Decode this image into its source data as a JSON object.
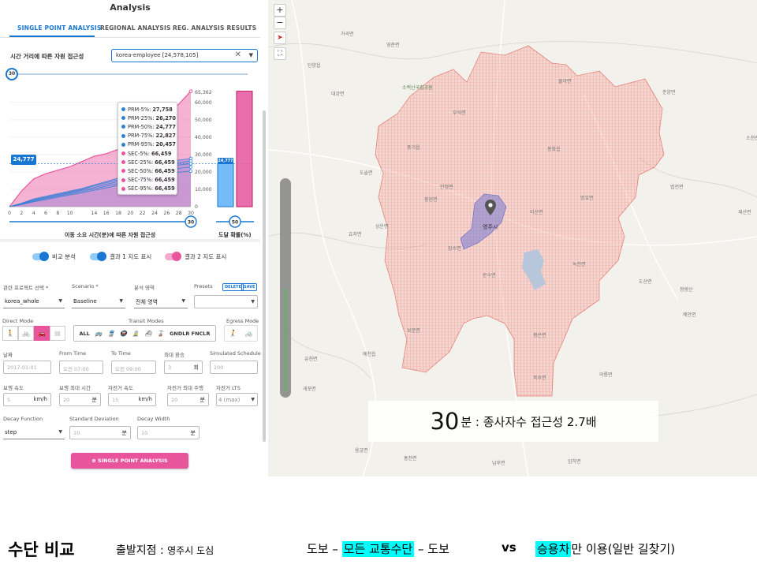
{
  "panel": {
    "title": "Analysis",
    "tabs": [
      "SINGLE POINT ANALYSIS",
      "REGIONAL ANALYSIS",
      "REG. ANALYSIS RESULTS"
    ],
    "accessibility_label": "시간 거리에 따른 자원 접근성",
    "dataset": "korea-employee [24,578,105]",
    "time_cutoff": "30",
    "value_badge": "24,777",
    "bar_badge": "24,777",
    "xaxis_title": "이동 소요 시간(분)에 따른 자원 접근성",
    "prob_title": "도달 확률(%)",
    "prob_value": "50",
    "toggles": {
      "compare": "비교 분석",
      "result1": "결과 1 지도 표시",
      "result2": "결과 2 지도 표시"
    },
    "fields": {
      "project_label": "관련 프로젝트 선택 *",
      "project_value": "korea_whole",
      "scenario_label": "Scenario *",
      "scenario_value": "Baseline",
      "area_label": "분석 영역",
      "area_value": "전체 영역",
      "presets_label": "Presets",
      "delete_label": "DELETE",
      "save_label": "SAVE",
      "direct_label": "Direct Mode",
      "transit_label": "Transit Modes",
      "egress_label": "Egress Mode",
      "transit_all": "ALL",
      "transit_extra": "GNDLR FNCLR",
      "date_label": "날짜",
      "date_value": "2017-01-01",
      "from_label": "From Time",
      "from_value": "오전 07:00",
      "to_label": "To Time",
      "to_value": "오전 09:00",
      "transfer_label": "최대 환승",
      "transfer_value": "3",
      "transfer_unit": "회",
      "sim_label": "Simulated Schedule",
      "sim_value": "200",
      "walk_speed_label": "보행 속도",
      "walk_speed_value": "5",
      "walk_speed_unit": "km/h",
      "walk_time_label": "보행 최대 시간",
      "walk_time_value": "20",
      "walk_time_unit": "분",
      "bike_speed_label": "자전거 속도",
      "bike_speed_value": "15",
      "bike_speed_unit": "km/h",
      "bike_time_label": "자전거 최대 주행",
      "bike_time_value": "20",
      "bike_time_unit": "분",
      "bike_lts_label": "자전거 LTS",
      "bike_lts_value": "4 (max)",
      "decay_label": "Decay Function",
      "decay_value": "step",
      "std_label": "Standard Deviation",
      "std_value": "10",
      "std_unit": "분",
      "width_label": "Decay Width",
      "width_value": "10",
      "width_unit": "분"
    },
    "run_label": "SINGLE POINT ANALYSIS"
  },
  "chart_data": {
    "type": "area",
    "x": [
      0,
      2,
      4,
      6,
      8,
      10,
      12,
      14,
      16,
      18,
      20,
      22,
      24,
      26,
      28,
      30
    ],
    "x_tick_labels": [
      "0",
      "2",
      "4",
      "6",
      "8",
      "10",
      "14",
      "16",
      "18",
      "20",
      "22",
      "24",
      "26",
      "28",
      "30"
    ],
    "y_tick_labels": [
      "0",
      "10,000",
      "20,000",
      "30,000",
      "40,000",
      "50,000",
      "60,000"
    ],
    "y_max_label": "65,362",
    "ylim": [
      0,
      65362
    ],
    "series": [
      {
        "name": "PRM-5%",
        "values": [
          0,
          2000,
          4500,
          6000,
          7500,
          9000,
          10500,
          12500,
          14500,
          16500,
          18500,
          21000,
          23500,
          25500,
          26800,
          27758
        ]
      },
      {
        "name": "PRM-25%",
        "values": [
          0,
          1800,
          4000,
          5500,
          7000,
          8500,
          10000,
          12000,
          13800,
          15500,
          17500,
          19500,
          21500,
          23500,
          25200,
          26270
        ]
      },
      {
        "name": "PRM-50%",
        "values": [
          0,
          1600,
          3600,
          5000,
          6500,
          8000,
          9500,
          11000,
          12800,
          14500,
          16500,
          18500,
          20500,
          22500,
          24000,
          24777
        ]
      },
      {
        "name": "PRM-75%",
        "values": [
          0,
          1400,
          3200,
          4600,
          6000,
          7400,
          8800,
          10200,
          11800,
          13500,
          15200,
          17000,
          19000,
          20800,
          22000,
          22827
        ]
      },
      {
        "name": "PRM-95%",
        "values": [
          0,
          1200,
          2800,
          4000,
          5400,
          6800,
          8000,
          9400,
          10800,
          12400,
          14000,
          15600,
          17200,
          18800,
          19800,
          20457
        ]
      },
      {
        "name": "SEC-5%",
        "values": [
          0,
          9000,
          16000,
          19000,
          21000,
          23000,
          26000,
          29000,
          30500,
          33000,
          37000,
          41000,
          46000,
          52000,
          59000,
          66459
        ]
      },
      {
        "name": "SEC-25%",
        "values": [
          0,
          9000,
          16000,
          19000,
          21000,
          23000,
          26000,
          29000,
          30500,
          33000,
          37000,
          41000,
          46000,
          52000,
          59000,
          66459
        ]
      },
      {
        "name": "SEC-50%",
        "values": [
          0,
          9000,
          16000,
          19000,
          21000,
          23000,
          26000,
          29000,
          30500,
          33000,
          37000,
          41000,
          46000,
          52000,
          59000,
          66459
        ]
      },
      {
        "name": "SEC-75%",
        "values": [
          0,
          9000,
          16000,
          19000,
          21000,
          23000,
          26000,
          29000,
          30500,
          33000,
          37000,
          41000,
          46000,
          52000,
          59000,
          66459
        ]
      },
      {
        "name": "SEC-95%",
        "values": [
          0,
          9000,
          16000,
          19000,
          21000,
          23000,
          26000,
          29000,
          30500,
          33000,
          37000,
          41000,
          46000,
          52000,
          59000,
          66459
        ]
      }
    ],
    "tooltip_values": [
      "27,758",
      "26,270",
      "24,777",
      "22,827",
      "20,457",
      "66,459",
      "66,459",
      "66,459",
      "66,459",
      "66,459"
    ],
    "bars": [
      {
        "name": "PRM",
        "value": 24777,
        "color": "#64b5f6"
      },
      {
        "name": "SEC",
        "value": 66459,
        "color": "#e8559d"
      }
    ],
    "colors": {
      "prm": "#2f7fd6",
      "sec": "#e8559d"
    }
  },
  "map": {
    "caption_time": "30",
    "caption_text": "분 : 종사자수 접근성 2.7배",
    "places": [
      "영주시",
      "봉화읍",
      "풍기읍",
      "안정면",
      "이산면",
      "문수면",
      "평은면",
      "장수면",
      "부석면",
      "봉현면",
      "상운면",
      "예천읍",
      "유천면",
      "개포면",
      "보문면",
      "용궁면",
      "홍천면",
      "남후면",
      "청량산",
      "단양읍",
      "대강면",
      "도솔면",
      "효자면",
      "물야면",
      "명호면",
      "재산면",
      "춘양면",
      "소천면",
      "법전면",
      "도산면",
      "녹전면",
      "예안면",
      "와룡면",
      "북후면",
      "임하면",
      "소백산국립공원",
      "영춘면",
      "가곡면"
    ]
  },
  "bottom": {
    "title": "수단 비교",
    "origin_label": "출발지점 :",
    "origin_value": "영주시 도심",
    "route_a": "도보 –",
    "route_hl": "모든 교통수단",
    "route_b": "– 도보",
    "vs": "vs",
    "car_hl": "승용차",
    "car_rest": "만 이용(일반 길찾기)"
  }
}
